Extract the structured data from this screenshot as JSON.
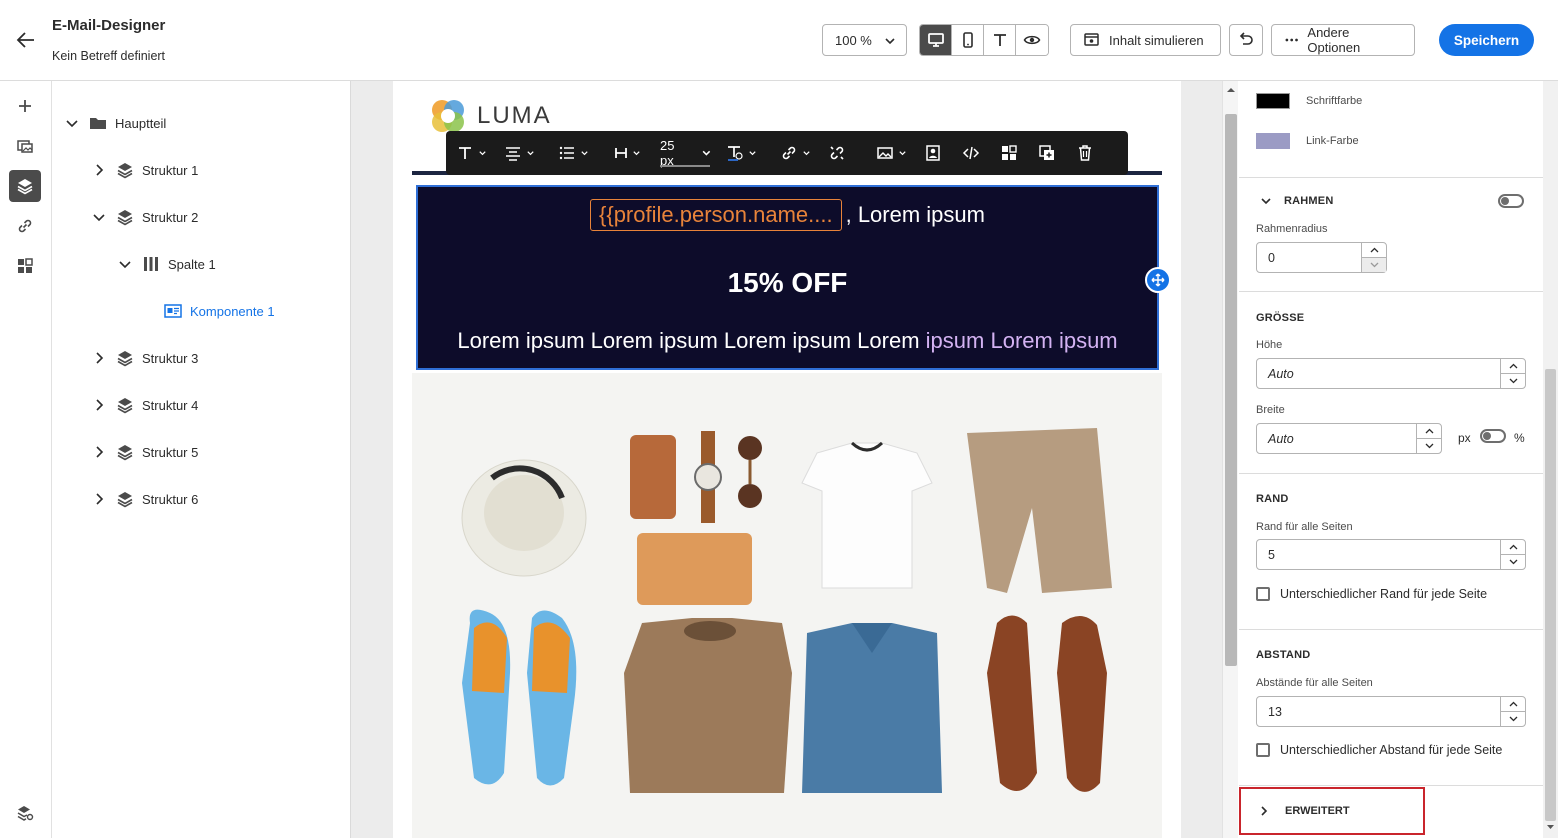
{
  "header": {
    "title": "E-Mail-Designer",
    "subtitle": "Kein Betreff definiert",
    "zoom": "100 %",
    "simulate_label": "Inhalt simulieren",
    "more_options_label": "Andere Optionen",
    "save_label": "Speichern"
  },
  "tree": {
    "root_label": "Hauptteil",
    "items": [
      {
        "label": "Struktur 1"
      },
      {
        "label": "Struktur 2"
      },
      {
        "label": "Spalte 1"
      },
      {
        "label": "Komponente 1"
      },
      {
        "label": "Struktur 3"
      },
      {
        "label": "Struktur 4"
      },
      {
        "label": "Struktur 5"
      },
      {
        "label": "Struktur 6"
      }
    ]
  },
  "toolbar": {
    "font_size": "25 px"
  },
  "email": {
    "logo_text": "LUMA",
    "token": "{{profile.person.name....",
    "line1_suffix": ", Lorem ipsum",
    "headline": "15% OFF",
    "line3_white": "Lorem ipsum Lorem ipsum Lorem ipsum Lorem",
    "line3_lavender": "ipsum Lorem ipsum"
  },
  "props": {
    "font_color_label": "Schriftfarbe",
    "font_color": "#000000",
    "link_color_label": "Link-Farbe",
    "link_color": "#9b9bc4",
    "border": {
      "title": "RAHMEN",
      "radius_label": "Rahmenradius",
      "radius_value": "0"
    },
    "size": {
      "title": "GRÖSSE",
      "height_label": "Höhe",
      "height_value": "Auto",
      "width_label": "Breite",
      "width_value": "Auto",
      "unit_px": "px",
      "unit_pct": "%"
    },
    "margin": {
      "title": "RAND",
      "all_label": "Rand für alle Seiten",
      "all_value": "5",
      "different_label": "Unterschiedlicher Rand für jede Seite"
    },
    "padding": {
      "title": "ABSTAND",
      "all_label": "Abstände für alle Seiten",
      "all_value": "13",
      "different_label": "Unterschiedlicher Abstand für jede Seite"
    },
    "advanced_title": "ERWEITERT"
  },
  "colors": {
    "accent": "#1473e6",
    "hero_bg": "#0d0c2a",
    "token": "#e8833a",
    "highlight_border": "#c9252c"
  }
}
